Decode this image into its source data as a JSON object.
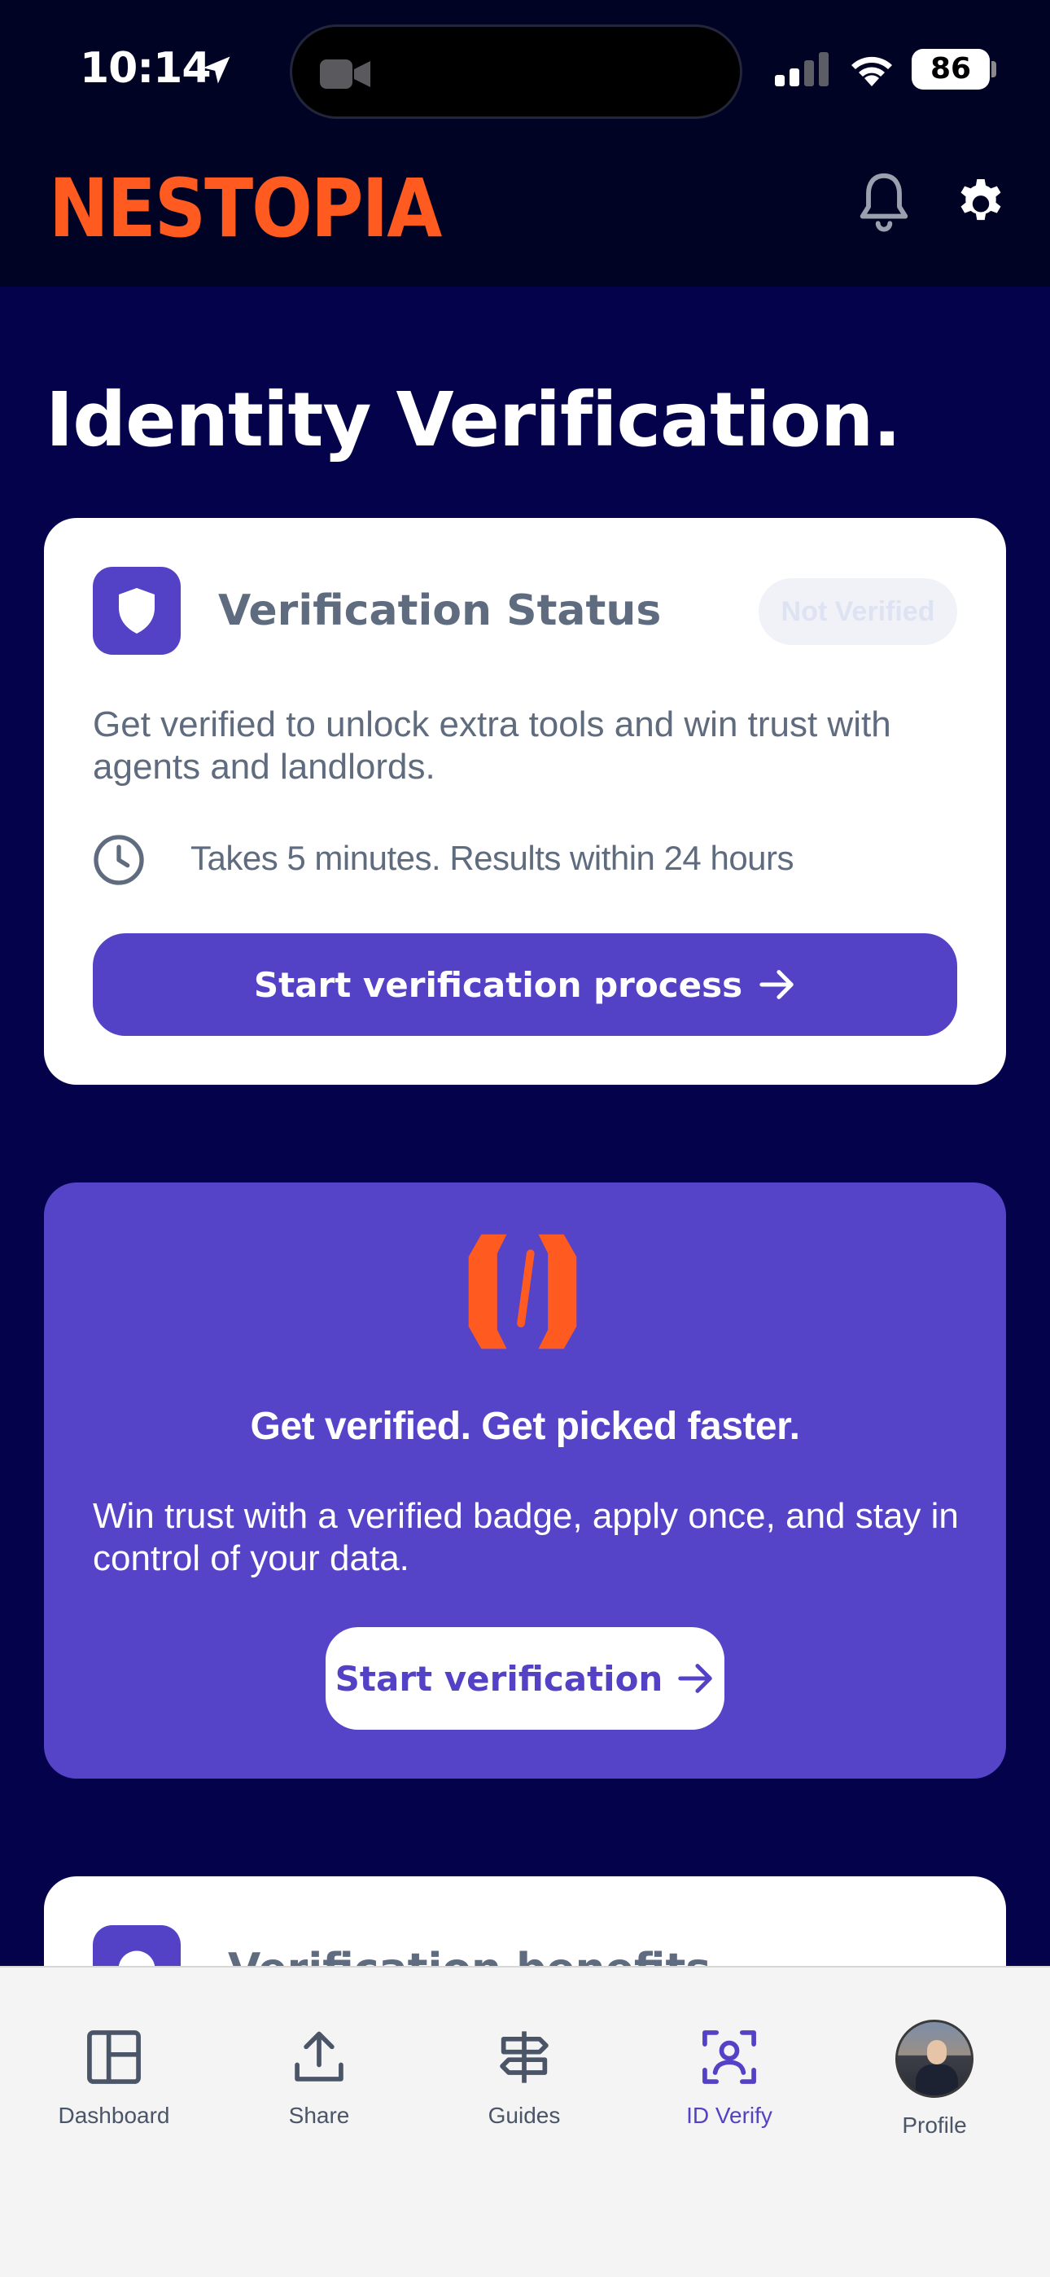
{
  "status_bar": {
    "time": "10:14",
    "battery": "86"
  },
  "header": {
    "brand": "NESTOPIA",
    "brand_color": "#ff5a1f",
    "icons": [
      "bell-icon",
      "gear-icon"
    ]
  },
  "page": {
    "title": "Identity Verification."
  },
  "status_card": {
    "title": "Verification Status",
    "badge": "Not Verified",
    "description": "Get verified to unlock extra tools and win trust with agents and landlords.",
    "time_note": "Takes 5 minutes. Results within 24 hours",
    "button_label": "Start verification process"
  },
  "promo_card": {
    "title": "Get verified. Get picked faster.",
    "description": "Win trust with a verified badge, apply once, and stay in control of your data.",
    "button_label": "Start verification"
  },
  "benefits_card": {
    "title": "Verification benefits"
  },
  "tab_bar": {
    "active": "ID Verify",
    "active_color": "#5442c6",
    "tabs": [
      {
        "label": "Dashboard",
        "icon": "dashboard-icon"
      },
      {
        "label": "Share",
        "icon": "share-icon"
      },
      {
        "label": "Guides",
        "icon": "signpost-icon"
      },
      {
        "label": "ID Verify",
        "icon": "id-verify-icon"
      },
      {
        "label": "Profile",
        "icon": "avatar"
      }
    ]
  },
  "colors": {
    "background": "#04024a",
    "primary": "#5442c6",
    "text_muted": "#5f6b7e"
  }
}
